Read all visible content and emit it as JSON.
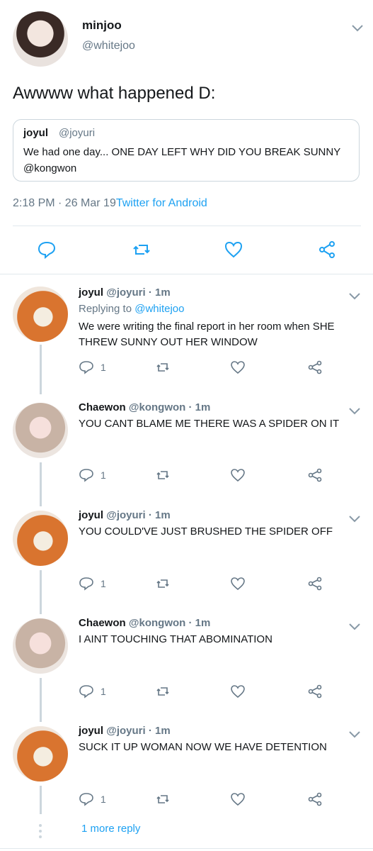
{
  "main": {
    "name": "minjoo",
    "handle": "@whitejoo",
    "text": "Awwww what happened D:",
    "quote": {
      "name": "joyul",
      "handle": "@joyuri",
      "text": "We had one day... ONE DAY LEFT WHY DID YOU BREAK SUNNY @kongwon"
    },
    "time": "2:18 PM · 26 Mar 19",
    "source": "Twitter for Android"
  },
  "replies": [
    {
      "name": "joyul",
      "handle": "@joyuri · 1m",
      "replying_prefix": "Replying to",
      "replying_to": "@whitejoo",
      "text": "We were writing the final report in her room when SHE THREW SUNNY OUT HER WINDOW",
      "count": "1"
    },
    {
      "name": "Chaewon",
      "handle": "@kongwon · 1m",
      "text": "YOU CANT BLAME ME THERE WAS A SPIDER ON IT",
      "count": "1"
    },
    {
      "name": "joyul",
      "handle": "@joyuri · 1m",
      "text": "YOU COULD'VE JUST BRUSHED THE SPIDER OFF",
      "count": "1"
    },
    {
      "name": "Chaewon",
      "handle": "@kongwon · 1m",
      "text": "I AINT TOUCHING THAT ABOMINATION",
      "count": "1"
    },
    {
      "name": "joyul",
      "handle": "@joyuri · 1m",
      "text": "SUCK IT UP WOMAN NOW WE HAVE DETENTION",
      "count": "1"
    }
  ],
  "more_replies": "1 more reply",
  "colors": {
    "accent": "#1da1f2",
    "muted": "#657786",
    "divider": "#e1e8ed"
  }
}
